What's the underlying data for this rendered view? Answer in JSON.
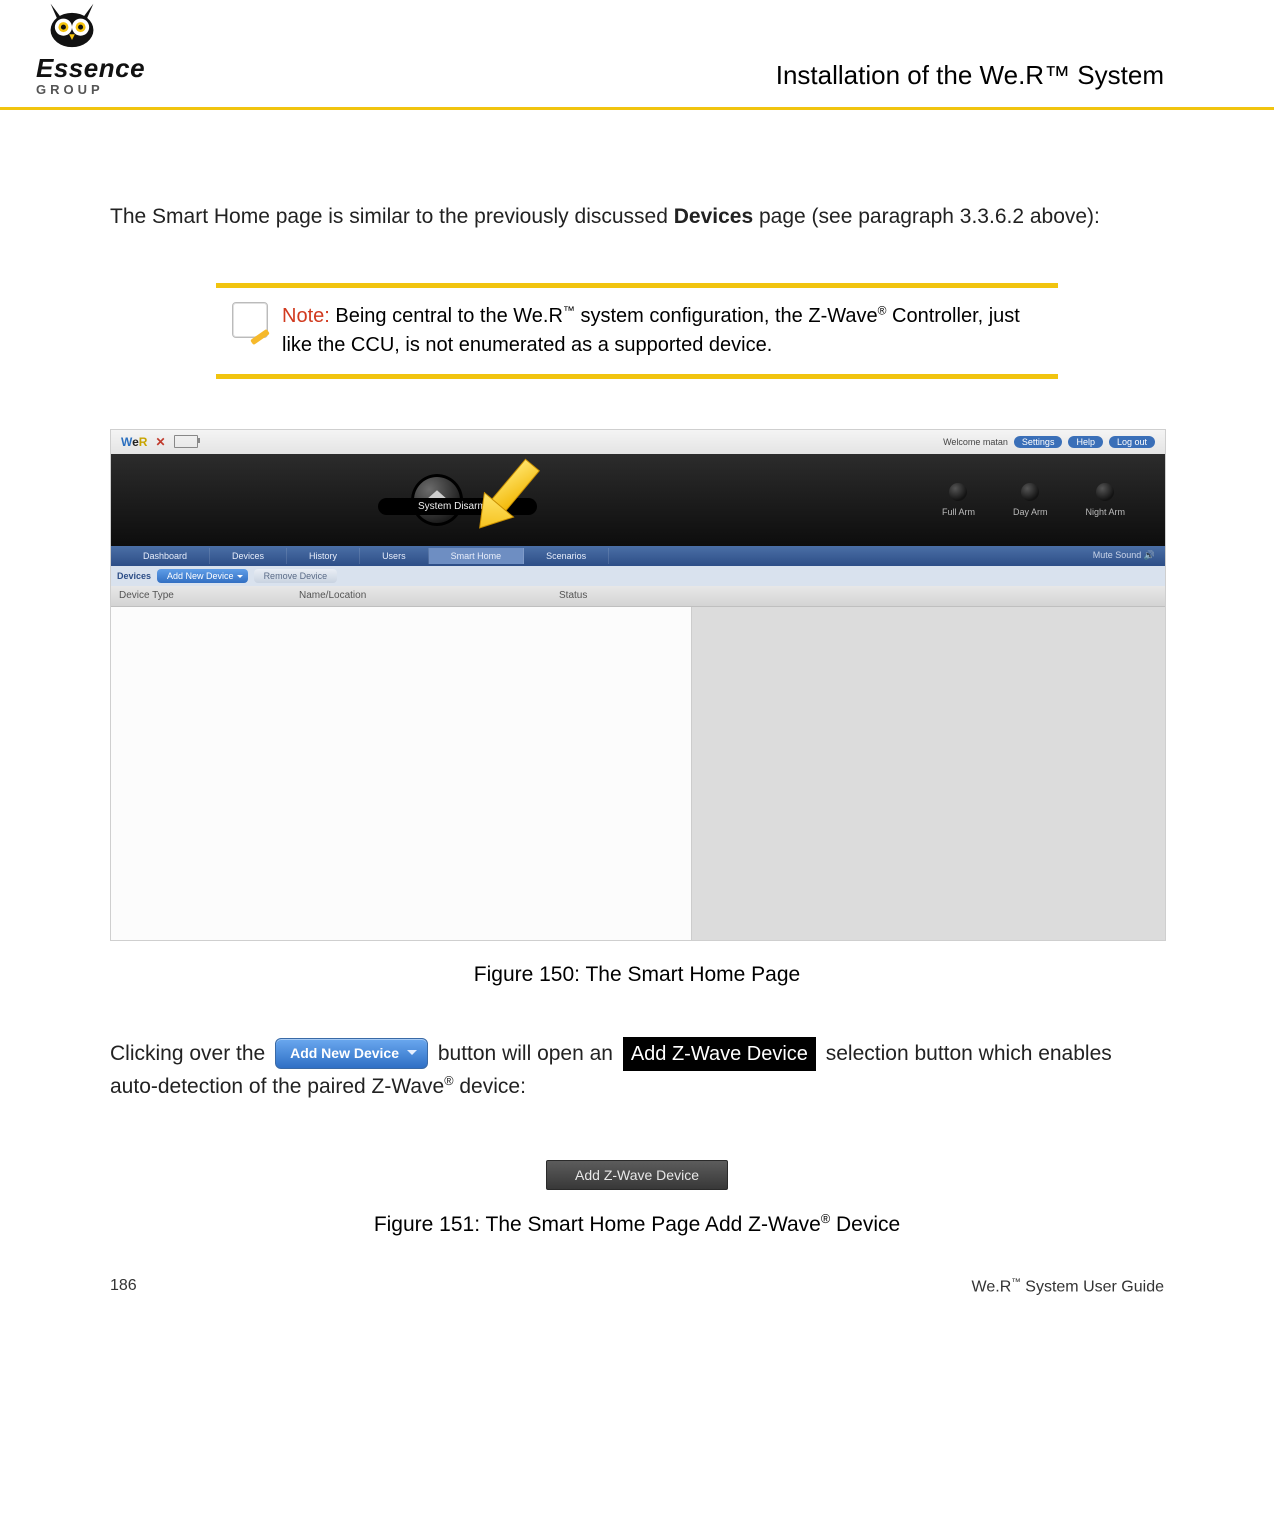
{
  "header": {
    "logo_text": "Essence",
    "logo_sub": "GROUP",
    "section_title": "Installation of the We.R™ System"
  },
  "intro": {
    "line1_pre": "The Smart Home page is similar to the previously discussed ",
    "line1_bold": "Devices",
    "line1_post": " page (see paragraph 3.3.6.2 above):"
  },
  "note": {
    "label": "Note:",
    "text_pre": " Being central to the We.R",
    "text_mid": " system configuration, the Z-Wave",
    "text_post": " Controller, just like the CCU, is not enumerated as a supported device."
  },
  "screenshot": {
    "logo": {
      "w": "W",
      "e": "e",
      "r": "R"
    },
    "topbar": {
      "welcome": "Welcome  matan",
      "links": [
        "Settings",
        "Help",
        "Log out"
      ]
    },
    "status": "System Disarmed",
    "arm_buttons": [
      "Full Arm",
      "Day Arm",
      "Night Arm"
    ],
    "tabs": [
      "Dashboard",
      "Devices",
      "History",
      "Users",
      "Smart Home",
      "Scenarios"
    ],
    "tabs_right": "Mute Sound",
    "subbar": {
      "label": "Devices",
      "add": "Add New Device",
      "remove": "Remove Device"
    },
    "columns": [
      "Device Type",
      "Name/Location",
      "Status"
    ]
  },
  "fig150_caption": "Figure 150: The Smart Home Page",
  "para2": {
    "pre": "Clicking over the ",
    "btn_label": "Add New Device",
    "mid": " button will open an ",
    "pill": " Add Z-Wave Device ",
    "post": " selection button which enables auto-detection of the paired Z-Wave",
    "tail": " device:"
  },
  "fig151_btn": "Add Z-Wave Device",
  "fig151_caption_pre": "Figure 151: The Smart Home Page Add Z-Wave",
  "fig151_caption_post": " Device",
  "footer": {
    "page": "186",
    "guide_pre": "We.R",
    "guide_post": " System User Guide"
  }
}
